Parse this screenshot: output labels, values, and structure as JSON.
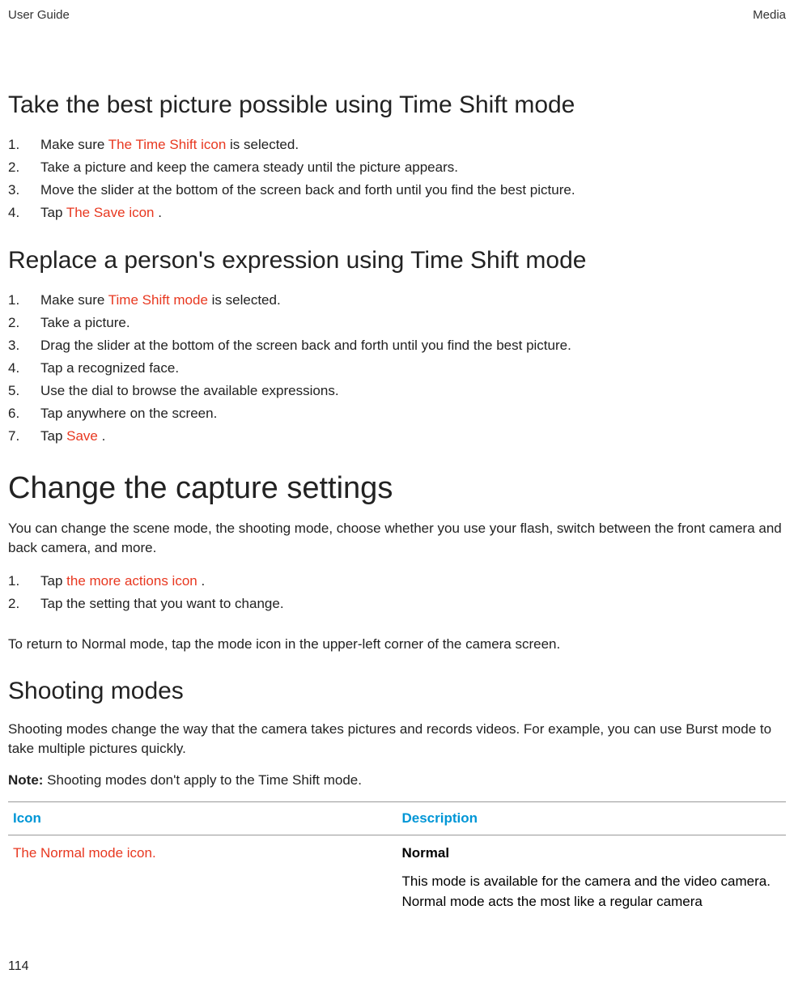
{
  "header": {
    "left": "User Guide",
    "right": "Media"
  },
  "section1": {
    "title": "Take the best picture possible using Time Shift mode",
    "steps": [
      {
        "num": "1.",
        "pre": "Make sure ",
        "red": " The Time Shift icon ",
        "post": " is selected."
      },
      {
        "num": "2.",
        "pre": "Take a picture and keep the camera steady until the picture appears.",
        "red": "",
        "post": ""
      },
      {
        "num": "3.",
        "pre": "Move the slider at the bottom of the screen back and forth until you find the best picture.",
        "red": "",
        "post": ""
      },
      {
        "num": "4.",
        "pre": "Tap ",
        "red": " The Save icon ",
        "post": "."
      }
    ]
  },
  "section2": {
    "title": "Replace a person's expression using Time Shift mode",
    "steps": [
      {
        "num": "1.",
        "pre": "Make sure ",
        "red": " Time Shift mode ",
        "post": " is selected."
      },
      {
        "num": "2.",
        "pre": "Take a picture.",
        "red": "",
        "post": ""
      },
      {
        "num": "3.",
        "pre": "Drag the slider at the bottom of the screen back and forth until you find the best picture.",
        "red": "",
        "post": ""
      },
      {
        "num": "4.",
        "pre": "Tap a recognized face.",
        "red": "",
        "post": ""
      },
      {
        "num": "5.",
        "pre": "Use the dial to browse the available expressions.",
        "red": "",
        "post": ""
      },
      {
        "num": "6.",
        "pre": "Tap anywhere on the screen.",
        "red": "",
        "post": ""
      },
      {
        "num": "7.",
        "pre": "Tap ",
        "red": " Save ",
        "post": "."
      }
    ]
  },
  "section3": {
    "title": "Change the capture settings",
    "intro": "You can change the scene mode, the shooting mode, choose whether you use your flash, switch between the front camera and back camera, and more.",
    "steps": [
      {
        "num": "1.",
        "pre": "Tap ",
        "red": " the more actions icon ",
        "post": "."
      },
      {
        "num": "2.",
        "pre": "Tap the setting that you want to change.",
        "red": "",
        "post": ""
      }
    ],
    "outro": "To return to Normal mode, tap the mode icon in the upper-left corner of the camera screen."
  },
  "section4": {
    "title": "Shooting modes",
    "intro": "Shooting modes change the way that the camera takes pictures and records videos. For example, you can use Burst mode to take multiple pictures quickly.",
    "note_label": "Note:",
    "note_text": " Shooting modes don't apply to the Time Shift mode.",
    "table": {
      "h1": "Icon",
      "h2": "Description",
      "row": {
        "icon": "The Normal mode icon.",
        "title": "Normal",
        "desc": "This mode is available for the camera and the video camera. Normal mode acts the most like a regular camera"
      }
    }
  },
  "page_number": "114"
}
